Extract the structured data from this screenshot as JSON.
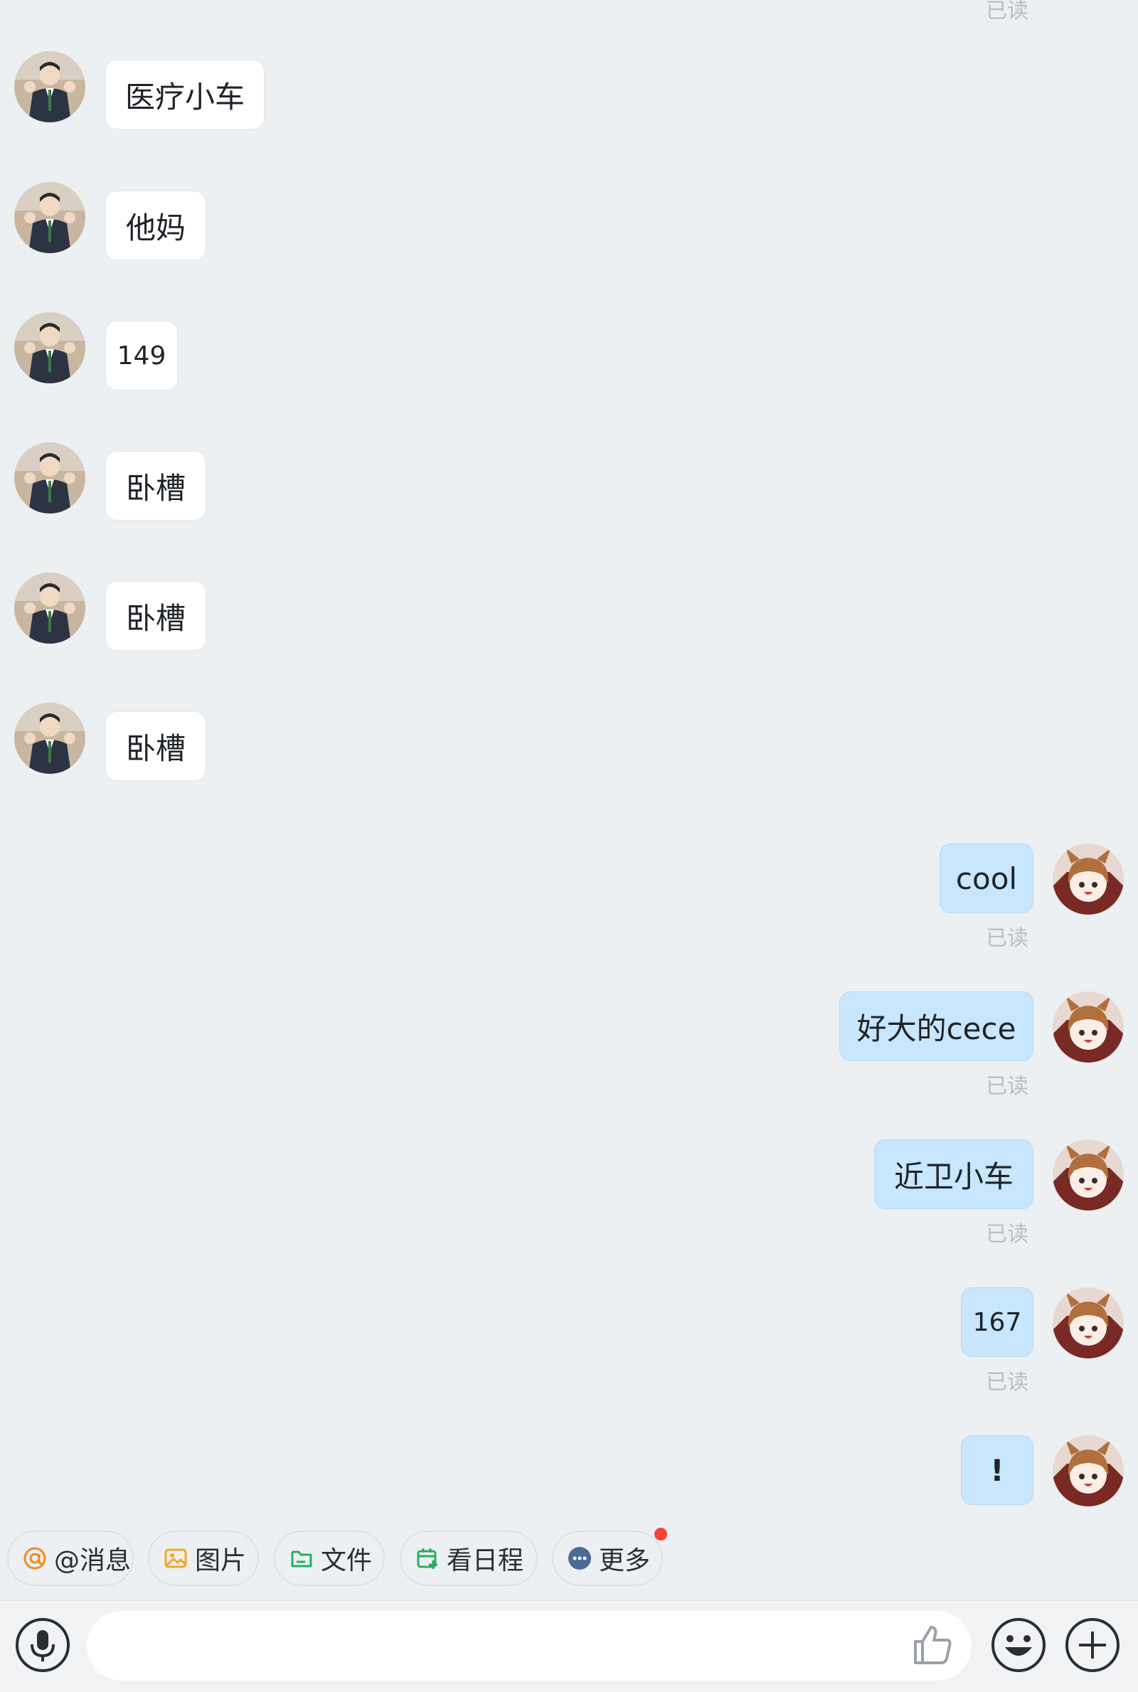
{
  "chat": {
    "top_read_label": "已读",
    "incoming": [
      {
        "text": "医疗小车"
      },
      {
        "text": "他妈"
      },
      {
        "text": "149"
      },
      {
        "text": "卧槽"
      },
      {
        "text": "卧槽"
      },
      {
        "text": "卧槽"
      }
    ],
    "outgoing": [
      {
        "text": "cool",
        "status": "已读"
      },
      {
        "text": "好大的cece",
        "status": "已读"
      },
      {
        "text": "近卫小车",
        "status": "已读"
      },
      {
        "text": "167",
        "status": "已读"
      },
      {
        "text": "!",
        "status": ""
      }
    ]
  },
  "quick_actions": [
    {
      "label": "@消息",
      "icon": "at-icon",
      "color": "#f08a24"
    },
    {
      "label": "图片",
      "icon": "image-icon",
      "color": "#f5a623"
    },
    {
      "label": "文件",
      "icon": "folder-icon",
      "color": "#27ae60"
    },
    {
      "label": "看日程",
      "icon": "calendar-icon",
      "color": "#27ae60"
    },
    {
      "label": "更多",
      "icon": "more-icon",
      "color": "#4a6a9a",
      "badge": true
    }
  ],
  "composer": {
    "placeholder": "",
    "value": ""
  },
  "colors": {
    "background": "#edf0f2",
    "outgoing_bubble": "#c8e6fd",
    "incoming_bubble": "#ffffff",
    "badge": "#f04438"
  }
}
